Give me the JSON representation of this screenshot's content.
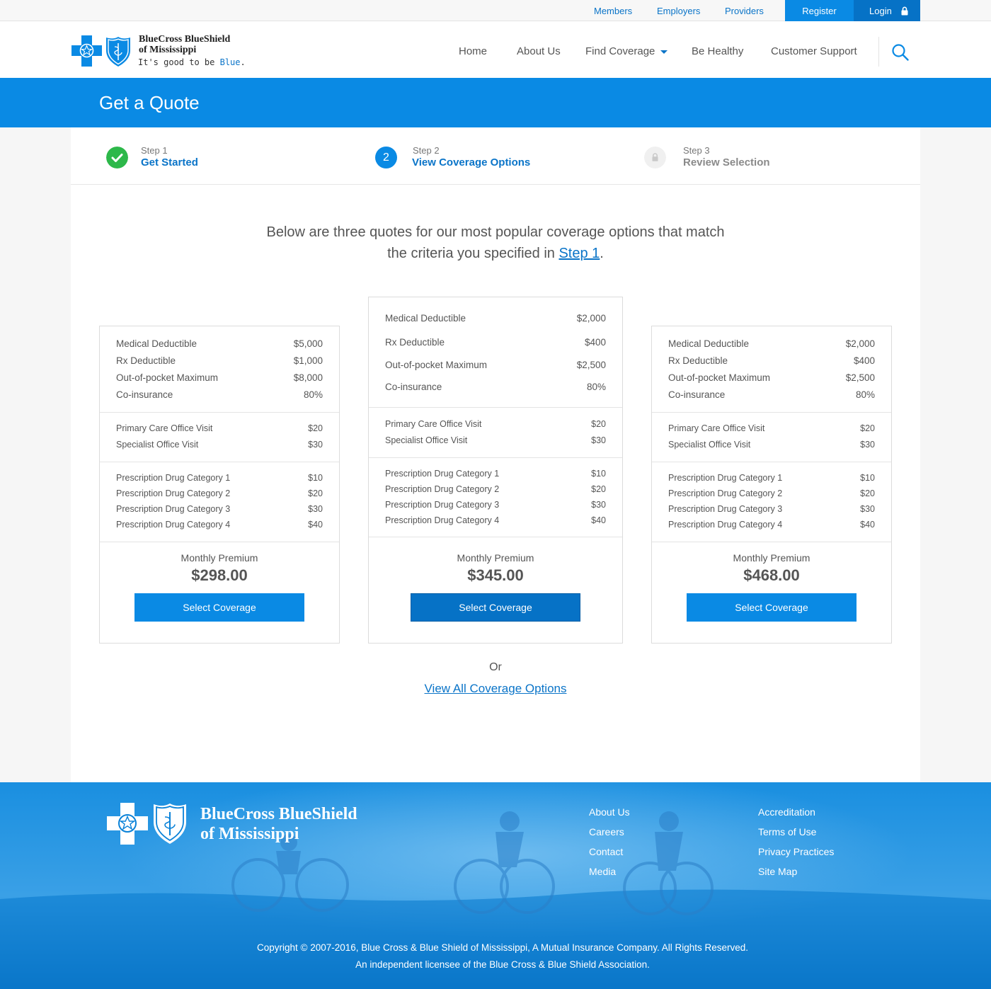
{
  "utility_bar": {
    "links": [
      "Members",
      "Employers",
      "Providers"
    ],
    "register_label": "Register",
    "login_label": "Login"
  },
  "brand": {
    "name_line1": "BlueCross BlueShield",
    "name_line2": "of Mississippi",
    "tagline_prefix": "It's good to be ",
    "tagline_blue": "Blue",
    "tagline_suffix": "."
  },
  "nav": {
    "items": [
      "Home",
      "About Us",
      "Find Coverage",
      "Be Healthy",
      "Customer Support"
    ]
  },
  "page_title": "Get a Quote",
  "steps": [
    {
      "number": "Step 1",
      "label": "Get Started",
      "state": "complete"
    },
    {
      "number": "Step 2",
      "label": "View Coverage Options",
      "state": "current",
      "badge": "2"
    },
    {
      "number": "Step 3",
      "label": "Review Selection",
      "state": "locked"
    }
  ],
  "intro": {
    "line1": "Below are three quotes for our most popular coverage options that match",
    "line2_prefix": "the criteria you specified in ",
    "link": "Step 1",
    "line2_suffix": "."
  },
  "quotes": [
    {
      "deductibles": [
        {
          "label": "Medical Deductible",
          "value": "$5,000"
        },
        {
          "label": "Rx Deductible",
          "value": "$1,000"
        },
        {
          "label": "Out-of-pocket Maximum",
          "value": "$8,000"
        },
        {
          "label": "Co-insurance",
          "value": "80%"
        }
      ],
      "visits": [
        {
          "label": "Primary Care Office Visit",
          "value": "$20"
        },
        {
          "label": "Specialist Office Visit",
          "value": "$30"
        }
      ],
      "drugs": [
        {
          "label": "Prescription Drug Category 1",
          "value": "$10"
        },
        {
          "label": "Prescription Drug Category 2",
          "value": "$20"
        },
        {
          "label": "Prescription Drug Category 3",
          "value": "$30"
        },
        {
          "label": "Prescription Drug Category 4",
          "value": "$40"
        }
      ],
      "premium_label": "Monthly Premium",
      "premium": "$298.00",
      "button": "Select Coverage"
    },
    {
      "deductibles": [
        {
          "label": "Medical Deductible",
          "value": "$2,000"
        },
        {
          "label": "Rx Deductible",
          "value": "$400"
        },
        {
          "label": "Out-of-pocket Maximum",
          "value": "$2,500"
        },
        {
          "label": "Co-insurance",
          "value": "80%"
        }
      ],
      "visits": [
        {
          "label": "Primary Care Office Visit",
          "value": "$20"
        },
        {
          "label": "Specialist Office Visit",
          "value": "$30"
        }
      ],
      "drugs": [
        {
          "label": "Prescription Drug Category 1",
          "value": "$10"
        },
        {
          "label": "Prescription Drug Category 2",
          "value": "$20"
        },
        {
          "label": "Prescription Drug Category 3",
          "value": "$30"
        },
        {
          "label": "Prescription Drug Category 4",
          "value": "$40"
        }
      ],
      "premium_label": "Monthly Premium",
      "premium": "$345.00",
      "button": "Select Coverage"
    },
    {
      "deductibles": [
        {
          "label": "Medical Deductible",
          "value": "$2,000"
        },
        {
          "label": "Rx Deductible",
          "value": "$400"
        },
        {
          "label": "Out-of-pocket Maximum",
          "value": "$2,500"
        },
        {
          "label": "Co-insurance",
          "value": "80%"
        }
      ],
      "visits": [
        {
          "label": "Primary Care Office Visit",
          "value": "$20"
        },
        {
          "label": "Specialist Office Visit",
          "value": "$30"
        }
      ],
      "drugs": [
        {
          "label": "Prescription Drug Category 1",
          "value": "$10"
        },
        {
          "label": "Prescription Drug Category 2",
          "value": "$20"
        },
        {
          "label": "Prescription Drug Category 3",
          "value": "$30"
        },
        {
          "label": "Prescription Drug Category 4",
          "value": "$40"
        }
      ],
      "premium_label": "Monthly Premium",
      "premium": "$468.00",
      "button": "Select Coverage"
    }
  ],
  "or_text": "Or",
  "view_all_link": "View All Coverage Options",
  "footer": {
    "brand_line1": "BlueCross BlueShield",
    "brand_line2": "of Mississippi",
    "links_col1": [
      "About Us",
      "Careers",
      "Contact",
      "Media"
    ],
    "links_col2": [
      "Accreditation",
      "Terms of Use",
      "Privacy Practices",
      "Site Map"
    ],
    "copyright_line1": "Copyright © 2007-2016, Blue Cross & Blue Shield of Mississippi, A Mutual Insurance Company. All Rights Reserved.",
    "copyright_line2": "An independent licensee of the Blue Cross & Blue Shield Association."
  },
  "colors": {
    "brand_blue": "#0a8ae4",
    "dark_blue": "#0672c6",
    "link_blue": "#0a74c8",
    "success_green": "#2db84a"
  }
}
